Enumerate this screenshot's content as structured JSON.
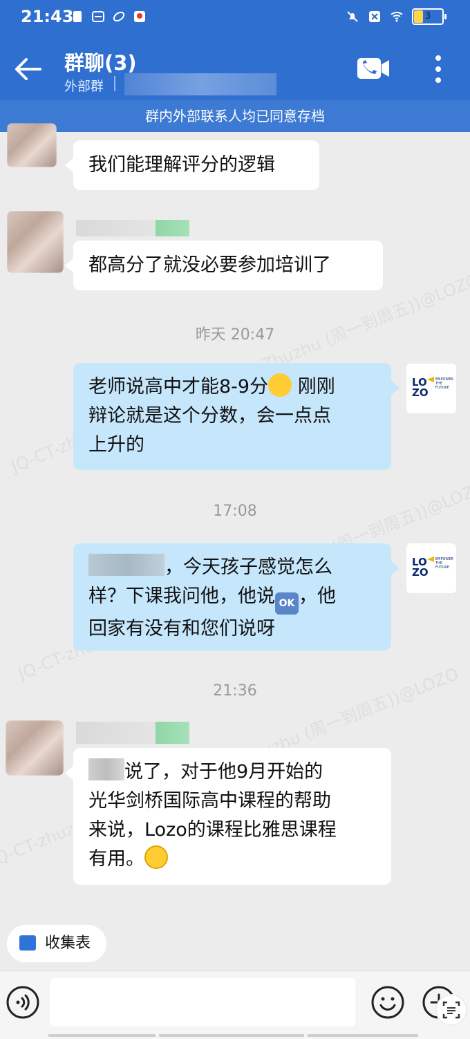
{
  "status_bar": {
    "time": "21:43",
    "battery": "3"
  },
  "header": {
    "title": "群聊(3)",
    "subtitle": "外部群"
  },
  "banner": "群内外部联系人均已同意存档",
  "watermark": "JQ-CT-zhuzhu-Bella(LOZO_JQ CT_Zhuzhu (周一到周五))@LOZO",
  "messages": {
    "m1": {
      "text": "我们能理解评分的逻辑"
    },
    "m2": {
      "text": "都高分了就没必要参加培训了"
    },
    "t1": "昨天  20:47",
    "m3": {
      "line1": "老师说高中才能8-9分",
      "line1b": " 刚刚",
      "line2": "辩论就是这个分数，会一点点",
      "line3": "上升的"
    },
    "t2": "17:08",
    "m4": {
      "line1": "，今天孩子感觉怎么",
      "line2a": "样？下课我问他，他说",
      "line2b": "，他",
      "line3": "回家有没有和您们说呀"
    },
    "t3": "21:36",
    "m5": {
      "line1": "说了，对于他9月开始的",
      "line2": "光华剑桥国际高中课程的帮助",
      "line3": "来说，Lozo的课程比雅思课程",
      "line4": "有用。"
    }
  },
  "logo": {
    "main_top": "LO",
    "main_bottom": "ZO",
    "tagline1": "EMPOWER",
    "tagline2": "THE",
    "tagline3": "FUTURE"
  },
  "emoji": {
    "ok": "OK"
  },
  "bottom": {
    "collect_label": "收集表"
  }
}
